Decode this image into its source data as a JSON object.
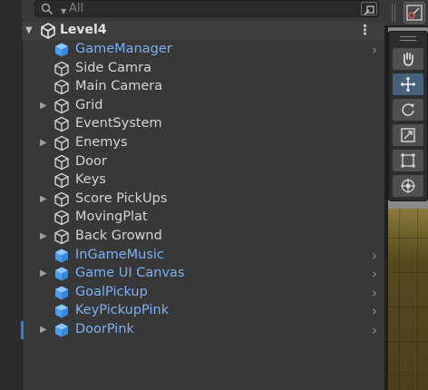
{
  "search": {
    "placeholder": "All"
  },
  "scene": {
    "name": "Level4",
    "menu_glyph": "⋮"
  },
  "hierarchy": [
    {
      "name": "GameManager",
      "prefab": true,
      "foldout": false,
      "chevron": true
    },
    {
      "name": "Side Camra",
      "prefab": false,
      "foldout": false,
      "chevron": false
    },
    {
      "name": "Main Camera",
      "prefab": false,
      "foldout": false,
      "chevron": false
    },
    {
      "name": "Grid",
      "prefab": false,
      "foldout": true,
      "chevron": false
    },
    {
      "name": "EventSystem",
      "prefab": false,
      "foldout": false,
      "chevron": false
    },
    {
      "name": "Enemys",
      "prefab": false,
      "foldout": true,
      "chevron": false
    },
    {
      "name": "Door",
      "prefab": false,
      "foldout": false,
      "chevron": false
    },
    {
      "name": "Keys",
      "prefab": false,
      "foldout": false,
      "chevron": false
    },
    {
      "name": "Score PickUps",
      "prefab": false,
      "foldout": true,
      "chevron": false
    },
    {
      "name": "MovingPlat",
      "prefab": false,
      "foldout": false,
      "chevron": false
    },
    {
      "name": "Back Grownd",
      "prefab": false,
      "foldout": true,
      "chevron": false
    },
    {
      "name": "InGameMusic",
      "prefab": true,
      "foldout": false,
      "chevron": true
    },
    {
      "name": "Game UI Canvas",
      "prefab": true,
      "foldout": true,
      "chevron": true
    },
    {
      "name": "GoalPickup",
      "prefab": true,
      "foldout": false,
      "chevron": true
    },
    {
      "name": "KeyPickupPink",
      "prefab": true,
      "foldout": false,
      "chevron": true
    },
    {
      "name": "DoorPink",
      "prefab": true,
      "foldout": true,
      "chevron": true
    }
  ],
  "scene_tools": {
    "active_tool": "move-tool",
    "tools": [
      "hand-tool",
      "move-tool",
      "rotate-tool",
      "scale-tool",
      "rect-tool",
      "transform-tool"
    ]
  },
  "colors": {
    "prefab_text": "#7cb1f3",
    "prefab_icon": "#4a9ef0",
    "selection_marker": "#2f7fd6"
  }
}
